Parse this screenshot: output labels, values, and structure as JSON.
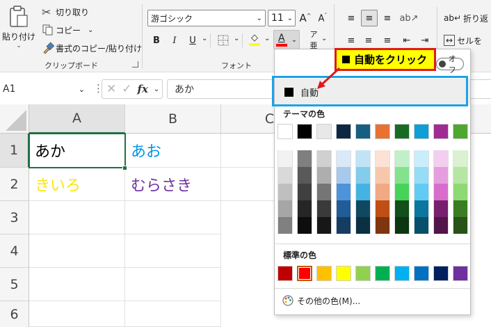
{
  "ribbon": {
    "clipboard": {
      "paste_label": "貼り付け",
      "cut_label": "切り取り",
      "copy_label": "コピー",
      "format_painter_label": "書式のコピー/貼り付け",
      "group_label": "クリップボード"
    },
    "font": {
      "font_name": "游ゴシック",
      "font_size": "11",
      "group_label": "フォント",
      "bold": "B",
      "italic": "I",
      "underline": "U",
      "font_color_letter": "A"
    },
    "wrap_label": "折り返",
    "merge_label": "セルを"
  },
  "formula_bar": {
    "name_box": "A1",
    "fx": "fx",
    "value": "あか"
  },
  "grid": {
    "columns": [
      "A",
      "B",
      "C"
    ],
    "rows": [
      "1",
      "2",
      "3",
      "4",
      "5",
      "6"
    ],
    "cells": {
      "a1": "あか",
      "b1": "あお",
      "a2": "きいろ",
      "b2": "むらさき"
    },
    "cell_colors": {
      "a1": "#000000",
      "b1": "#0096e6",
      "a2": "#ffe600",
      "b2": "#7030a0"
    }
  },
  "dropdown": {
    "auto_label": "自動",
    "toggle_label": "オフ",
    "theme_colors_label": "テーマの色",
    "theme_colors": [
      [
        "#ffffff",
        "#f2f2f2",
        "#d9d9d9",
        "#bfbfbf",
        "#a6a6a6",
        "#808080"
      ],
      [
        "#000000",
        "#7f7f7f",
        "#595959",
        "#404040",
        "#262626",
        "#0d0d0d"
      ],
      [
        "#e8e8e8",
        "#d0d0d0",
        "#aeaeae",
        "#757575",
        "#3a3a3a",
        "#171717"
      ],
      [
        "#0e2841",
        "#dae9f8",
        "#a6c9ec",
        "#4d93d9",
        "#215c98",
        "#153d64"
      ],
      [
        "#156082",
        "#c0e4f5",
        "#83cceb",
        "#44b3e1",
        "#104862",
        "#0a3041"
      ],
      [
        "#e97132",
        "#fbe2d5",
        "#f7c7ac",
        "#f1a983",
        "#c04f15",
        "#7f350e"
      ],
      [
        "#196b24",
        "#c1f0c8",
        "#83e28e",
        "#47d359",
        "#124f1a",
        "#0c3511"
      ],
      [
        "#0f9ed5",
        "#caedfb",
        "#95dcf7",
        "#61cbf3",
        "#0b76a0",
        "#074f6a"
      ],
      [
        "#a02b93",
        "#f2cfee",
        "#e59edd",
        "#d86dcd",
        "#77206d",
        "#501549"
      ],
      [
        "#4ea72e",
        "#daf2d0",
        "#b5e6a2",
        "#8ed973",
        "#3a7d22",
        "#275317"
      ]
    ],
    "standard_colors_label": "標準の色",
    "standard_colors": [
      "#c00000",
      "#ff0000",
      "#ffc000",
      "#ffff00",
      "#92d050",
      "#00b050",
      "#00b0f0",
      "#0070c0",
      "#002060",
      "#7030a0"
    ],
    "more_colors_label": "その他の色(M)..."
  },
  "callout": {
    "text": "自動をクリック"
  },
  "colors": {
    "callout_border": "#e0191a",
    "highlight_border": "#1aa3e8",
    "selected_cell_border": "#1e7145"
  }
}
